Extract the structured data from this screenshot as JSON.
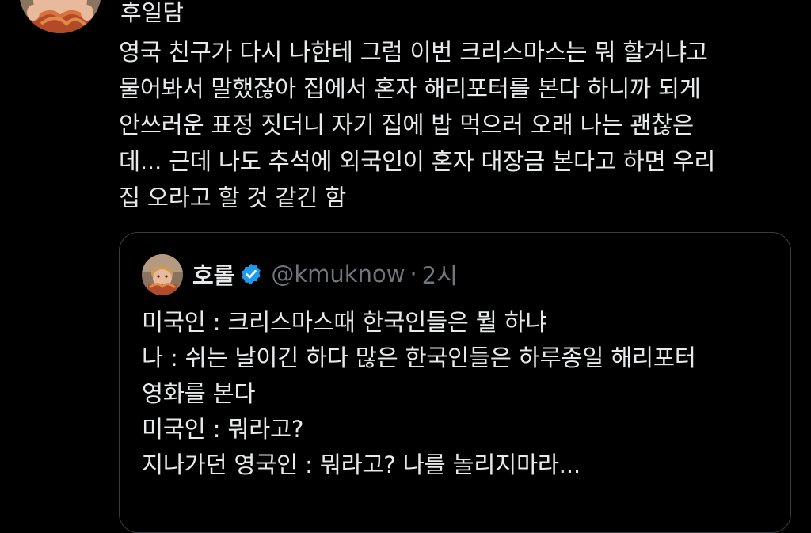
{
  "tweet": {
    "author_name": "후일담",
    "lines": [
      "영국 친구가 다시 나한테 그럼 이번 크리스마스는 뭐 할거냐고",
      "물어봐서 말했잖아 집에서 혼자 해리포터를 본다 하니까 되게",
      "안쓰러운 표정 짓더니 자기 집에 밥 먹으러 오래 나는 괜찮은",
      "데... 근데 나도 추석에 외국인이 혼자 대장금 본다고 하면 우리",
      "집 오라고 할 것 같긴 함"
    ]
  },
  "quote": {
    "name": "호롤",
    "handle": "@kmuknow",
    "separator": "·",
    "time": "2시",
    "lines": [
      "미국인 : 크리스마스때 한국인들은 뭘 하냐",
      "나 : 쉬는 날이긴 하다 많은 한국인들은 하루종일 해리포터",
      "영화를 본다",
      "미국인 : 뭐라고?",
      "지나가던 영국인 : 뭐라고? 나를 놀리지마라..."
    ]
  },
  "icons": {
    "avatar": "avatar-photo",
    "verified": "verified-badge-icon"
  },
  "colors": {
    "background": "#000000",
    "text": "#e7e9ea",
    "secondary_text": "#71767b",
    "verified_blue": "#1d9bf0",
    "card_border": "#3a3d40"
  }
}
